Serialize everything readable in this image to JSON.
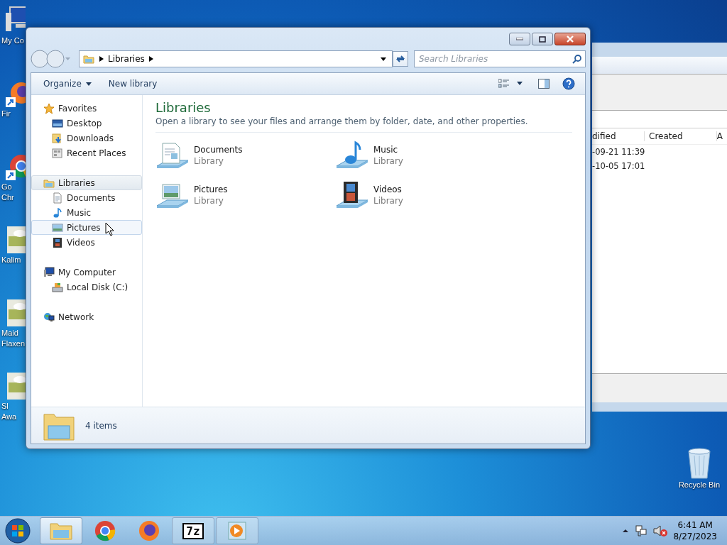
{
  "desktop": {
    "icons": [
      {
        "kind": "computer",
        "lines": [
          "My Co"
        ]
      },
      {
        "kind": "firefox",
        "lines": [
          "Fir"
        ]
      },
      {
        "kind": "chrome",
        "lines": [
          "Go",
          "Chr"
        ]
      },
      {
        "kind": "thumbnail",
        "lines": [
          "Kalim"
        ]
      },
      {
        "kind": "thumbnail",
        "lines": [
          "Maid",
          "Flaxen"
        ]
      },
      {
        "kind": "thumbnail",
        "lines": [
          "Sl",
          "Awa"
        ]
      }
    ],
    "recycle_bin": {
      "label": "Recycle Bin"
    }
  },
  "background_window": {
    "columns": [
      "dified",
      "Created",
      "A"
    ],
    "rows": [
      [
        "-09-21 11:39"
      ],
      [
        "-10-05 17:01"
      ]
    ]
  },
  "window": {
    "address": {
      "crumbs": [
        "Libraries"
      ]
    },
    "search": {
      "placeholder": "Search Libraries"
    },
    "toolbar": [
      {
        "label": "Organize",
        "menu": true
      },
      {
        "label": "New library",
        "menu": false
      }
    ],
    "nav": [
      {
        "label": "Favorites",
        "kind": "star",
        "selected": false,
        "hovered": false,
        "children": [
          {
            "label": "Desktop",
            "kind": "desktop",
            "selected": false,
            "hovered": false
          },
          {
            "label": "Downloads",
            "kind": "downloads",
            "selected": false,
            "hovered": false
          },
          {
            "label": "Recent Places",
            "kind": "recent",
            "selected": false,
            "hovered": false
          }
        ]
      },
      {
        "label": "Libraries",
        "kind": "library",
        "selected": true,
        "hovered": false,
        "children": [
          {
            "label": "Documents",
            "kind": "document",
            "selected": false,
            "hovered": false
          },
          {
            "label": "Music",
            "kind": "music",
            "selected": false,
            "hovered": false
          },
          {
            "label": "Pictures",
            "kind": "pictures",
            "selected": false,
            "hovered": true
          },
          {
            "label": "Videos",
            "kind": "videos",
            "selected": false,
            "hovered": false
          }
        ]
      },
      {
        "label": "My Computer",
        "kind": "computer",
        "selected": false,
        "hovered": false,
        "children": [
          {
            "label": "Local Disk (C:)",
            "kind": "disk",
            "selected": false,
            "hovered": false
          }
        ]
      },
      {
        "label": "Network",
        "kind": "network",
        "selected": false,
        "hovered": false
      }
    ],
    "content": {
      "title": "Libraries",
      "description": "Open a library to see your files and arrange them by folder, date, and other properties.",
      "items": [
        {
          "name": "Documents",
          "type": "Library",
          "kind": "document"
        },
        {
          "name": "Music",
          "type": "Library",
          "kind": "music"
        },
        {
          "name": "Pictures",
          "type": "Library",
          "kind": "pictures"
        },
        {
          "name": "Videos",
          "type": "Library",
          "kind": "videos"
        }
      ]
    },
    "status": "4 items"
  },
  "taskbar": {
    "apps": [
      {
        "kind": "explorer",
        "selected": true
      },
      {
        "kind": "chrome",
        "selected": false
      },
      {
        "kind": "firefox",
        "selected": false
      },
      {
        "kind": "archiver",
        "text": "7z",
        "selected": false
      },
      {
        "kind": "player",
        "selected": false
      }
    ],
    "clock": {
      "time": "6:41 AM",
      "date": "8/27/2023"
    }
  }
}
